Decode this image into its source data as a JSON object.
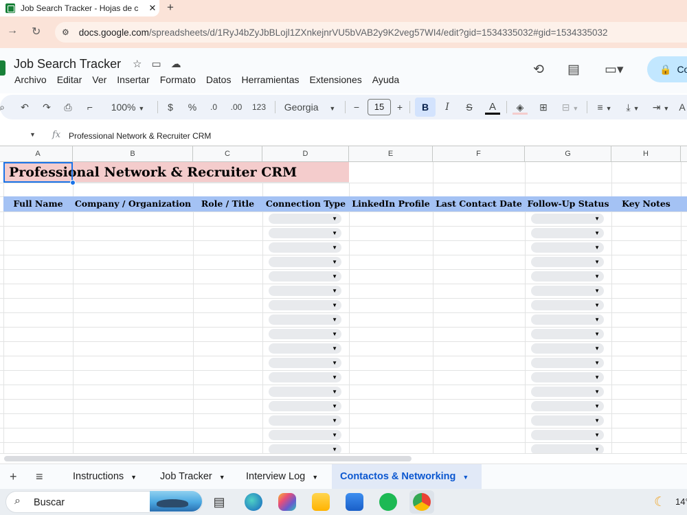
{
  "browser": {
    "tab_title": "Job Search Tracker - Hojas de c",
    "tab_close": "✕",
    "new_tab": "+",
    "back": "→",
    "reload": "↻",
    "url_host": "docs.google.com",
    "url_path": "/spreadsheets/d/1RyJ4bZyJbBLojl1ZXnkejnrVU5bVAB2y9K2veg57WI4/edit?gid=1534335032#gid=1534335032"
  },
  "doc": {
    "title": "Job Search Tracker",
    "menu": [
      "Archivo",
      "Editar",
      "Ver",
      "Insertar",
      "Formato",
      "Datos",
      "Herramientas",
      "Extensiones",
      "Ayuda"
    ],
    "share_label": "Co"
  },
  "toolbar": {
    "zoom": "100%",
    "currency": "$",
    "percent": "%",
    "dec_decrease": ".0",
    "dec_increase": ".00",
    "number_format": "123",
    "font": "Georgia",
    "font_size": "15",
    "bold": "B",
    "italic": "I",
    "strike": "S",
    "text_color": "A"
  },
  "formula_bar": {
    "fx": "fx",
    "content": "Professional Network & Recruiter CRM"
  },
  "columns": [
    "A",
    "B",
    "C",
    "D",
    "E",
    "F",
    "G",
    "H"
  ],
  "sheet": {
    "title": "Professional Network & Recruiter CRM",
    "headers": [
      "Full Name",
      "Company / Organization",
      "Role / Title",
      "Connection Type",
      "LinkedIn Profile",
      "Last Contact Date",
      "Follow-Up Status",
      "Key Notes"
    ],
    "dropdown_rows": 17,
    "title_fill": "#f4cccc",
    "header_fill": "#a4c2f4"
  },
  "sheet_tabs": [
    {
      "label": "Instructions",
      "active": false
    },
    {
      "label": "Job Tracker",
      "active": false
    },
    {
      "label": "Interview Log",
      "active": false
    },
    {
      "label": "Contactos & Networking",
      "active": true
    }
  ],
  "taskbar": {
    "search_placeholder": "Buscar",
    "temperature": "14°"
  }
}
